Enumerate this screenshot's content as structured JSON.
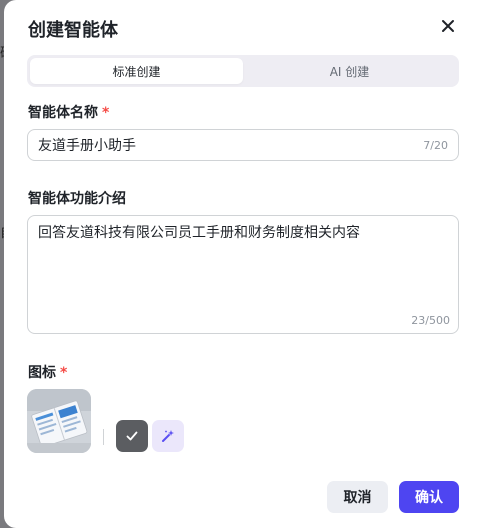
{
  "dialog": {
    "title": "创建智能体",
    "close_icon": "close-icon"
  },
  "tabs": [
    {
      "label": "标准创建",
      "active": true
    },
    {
      "label": "AI 创建",
      "active": false
    }
  ],
  "name_field": {
    "label": "智能体名称",
    "required_mark": "*",
    "value": "友道手册小助手",
    "counter": "7/20"
  },
  "intro_field": {
    "label": "智能体功能介绍",
    "value": "回答友道科技有限公司员工手册和财务制度相关内容",
    "counter": "23/500"
  },
  "icon_field": {
    "label": "图标",
    "required_mark": "*",
    "options": [
      {
        "icon": "check-icon",
        "selected": true
      },
      {
        "icon": "magic-wand-icon",
        "selected": false
      }
    ]
  },
  "footer": {
    "cancel_label": "取消",
    "confirm_label": "确认"
  },
  "colors": {
    "accent": "#4e45f1",
    "required": "#f54a45"
  }
}
